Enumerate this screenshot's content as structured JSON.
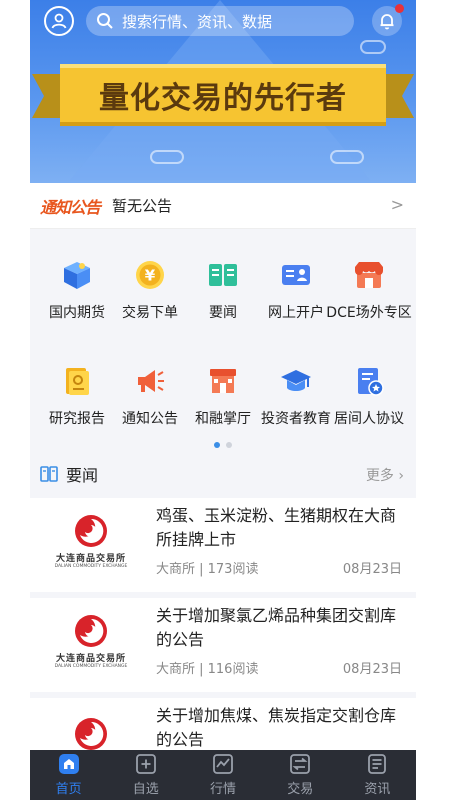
{
  "header": {
    "search_placeholder": "搜索行情、资讯、数据",
    "banner_slogan": "量化交易的先行者"
  },
  "notice": {
    "tag": "通知公告",
    "text": "暂无公告",
    "chevron": ">"
  },
  "grid": {
    "items": [
      {
        "label": "国内期货",
        "icon": "futures-box-icon"
      },
      {
        "label": "交易下单",
        "icon": "yen-coin-icon"
      },
      {
        "label": "要闻",
        "icon": "open-book-icon"
      },
      {
        "label": "网上开户",
        "icon": "id-card-icon"
      },
      {
        "label": "DCE场外专区",
        "icon": "storefront-icon"
      },
      {
        "label": "研究报告",
        "icon": "report-document-icon"
      },
      {
        "label": "通知公告",
        "icon": "megaphone-icon"
      },
      {
        "label": "和融掌厅",
        "icon": "building-icon"
      },
      {
        "label": "投资者教育",
        "icon": "graduation-cap-icon"
      },
      {
        "label": "居间人协议",
        "icon": "agreement-badge-icon"
      }
    ]
  },
  "news": {
    "title": "要闻",
    "more": "更多 ›",
    "thumb_cn": "大连商品交易所",
    "thumb_en": "DALIAN COMMODITY EXCHANGE",
    "items": [
      {
        "title": "鸡蛋、玉米淀粉、生猪期权在大商所挂牌上市",
        "meta": "大商所 | 173阅读",
        "date": "08月23日"
      },
      {
        "title": "关于增加聚氯乙烯品种集团交割库的公告",
        "meta": "大商所 | 116阅读",
        "date": "08月23日"
      },
      {
        "title": "关于增加焦煤、焦炭指定交割仓库的公告",
        "meta": "",
        "date": ""
      }
    ]
  },
  "tabbar": {
    "tabs": [
      {
        "label": "首页",
        "active": true
      },
      {
        "label": "自选",
        "active": false
      },
      {
        "label": "行情",
        "active": false
      },
      {
        "label": "交易",
        "active": false
      },
      {
        "label": "资讯",
        "active": false
      }
    ]
  },
  "colors": {
    "accent": "#2f7ff0",
    "banner_blue": "#3c7fe8",
    "ribbon_gold": "#f6c431",
    "notice_orange": "#e8561e",
    "tabbar_bg": "#2a2d35"
  }
}
